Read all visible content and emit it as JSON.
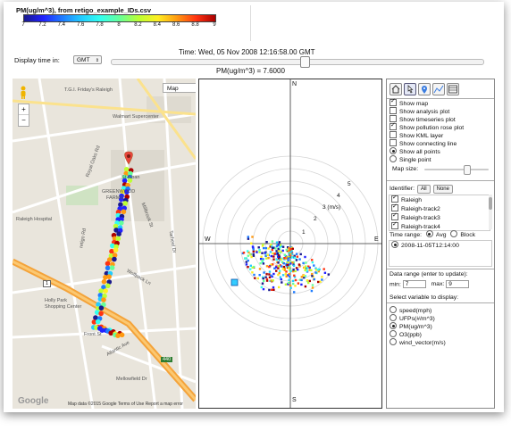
{
  "colorbar": {
    "title": "PM(ug/m^3), from retigo_example_IDs.csv",
    "ticks": [
      "7",
      "7.2",
      "7.4",
      "7.6",
      "7.8",
      "8",
      "8.2",
      "8.4",
      "8.6",
      "8.8",
      "9"
    ],
    "colors": [
      "#1a1a8c",
      "#2222ff",
      "#1f7cff",
      "#22ccff",
      "#33ffee",
      "#66ff99",
      "#bbff33",
      "#ffee22",
      "#ff9911",
      "#ff3311",
      "#aa0000"
    ]
  },
  "time": {
    "label": "Time: Wed, 05 Nov 2008 12:16:58.00 GMT",
    "display_label": "Display time in:",
    "timezone": "GMT"
  },
  "pm_readout": "PM(ug/m^3) = 7.6000",
  "map": {
    "type_select": "Map",
    "zoom_in": "+",
    "zoom_out": "−",
    "labels": {
      "fridays": "T.G.I. Friday's Raleigh",
      "walmart": "Walmart Supercenter",
      "hospital": "Raleigh Hospital",
      "hollypark1": "Holly Park",
      "hollypark2": "Shopping Center",
      "greenwood": "GREENWOOD",
      "farms": "FARMS",
      "st_alban": "St Alban",
      "millbrook": "Millbrook St",
      "front": "Front St",
      "atlantic": "Atlantic Ave",
      "wolfpack": "Wolfpack Ln",
      "tarheel": "Tarheel Dr",
      "melbourne": "Mellowfield Dr",
      "retigo": "retigo Rd",
      "royal": "Royal Oaks Rd",
      "i440": "440",
      "i1": "1"
    },
    "google": "Google",
    "footer": "Map data ©2015 Google   Terms of Use   Report a map error"
  },
  "rose": {
    "north": "N",
    "south": "S",
    "east": "E",
    "west": "W",
    "rings": [
      "1",
      "2",
      "3 (m/s)",
      "4",
      "5"
    ]
  },
  "panel": {
    "icons": [
      "home-icon",
      "pointer-icon",
      "marker-icon",
      "graph-icon",
      "table-icon"
    ],
    "options": [
      {
        "label": "Show map",
        "checked": true
      },
      {
        "label": "Show analysis plot",
        "checked": false
      },
      {
        "label": "Show timeseries plot",
        "checked": false
      },
      {
        "label": "Show pollution rose plot",
        "checked": true
      },
      {
        "label": "Show KML layer",
        "checked": false
      },
      {
        "label": "Show connecting line",
        "checked": false
      }
    ],
    "points_all": "Show all points",
    "points_single": "Single point",
    "map_size": "Map size:",
    "identifier_label": "Identifier:",
    "all_btn": "All",
    "none_btn": "None",
    "identifiers": [
      "Raleigh",
      "Raleigh-track2",
      "Raleigh-track3",
      "Raleigh-track4"
    ],
    "time_range_label": "Time range:",
    "avg": "Avg",
    "block": "Block",
    "time_item": "2008-11-05T12:14:00",
    "data_range_label": "Data range (enter to update):",
    "min_label": "min:",
    "min_value": "7",
    "max_label": "max:",
    "max_value": "9",
    "select_var_label": "Select variable to display:",
    "variables": [
      {
        "label": "speed(mph)",
        "selected": false
      },
      {
        "label": "UFPs(#/m^3)",
        "selected": false
      },
      {
        "label": "PM(ug/m^3)",
        "selected": true
      },
      {
        "label": "O3(ppb)",
        "selected": false
      },
      {
        "label": "wind_vector(m/s)",
        "selected": false
      }
    ]
  }
}
